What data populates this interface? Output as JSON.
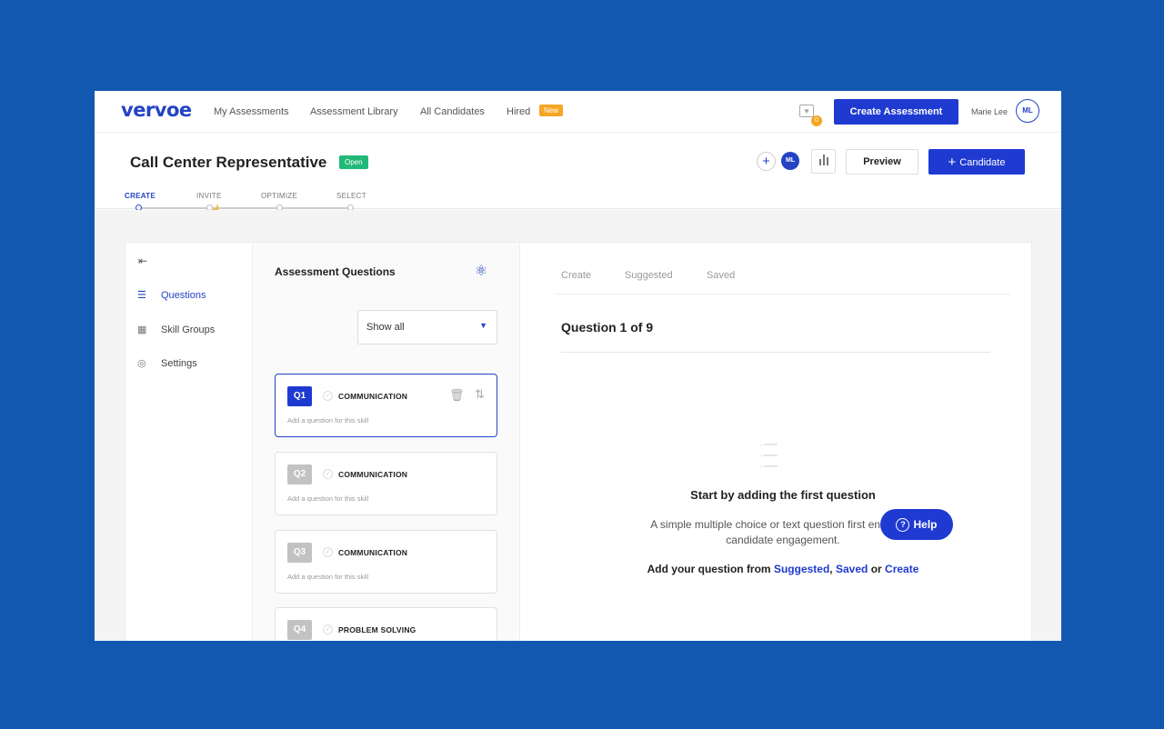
{
  "brand": {
    "logo": "vervoe"
  },
  "topnav": {
    "links": [
      "My Assessments",
      "Assessment Library",
      "All Candidates",
      "Hired"
    ],
    "hired_badge": "New",
    "favorites_count": "0",
    "create_button": "Create Assessment",
    "user_name": "Marie Lee",
    "user_initials": "ML"
  },
  "header": {
    "title": "Call Center Representative",
    "status": "Open",
    "collaborator_initials": "ML",
    "preview_button": "Preview",
    "candidate_button": "Candidate",
    "steps": [
      "CREATE",
      "INVITE",
      "OPTIMIZE",
      "SELECT"
    ],
    "active_step": "CREATE"
  },
  "sidebar": {
    "items": [
      {
        "label": "Questions",
        "icon": "list-icon",
        "active": true
      },
      {
        "label": "Skill Groups",
        "icon": "grid-icon",
        "active": false
      },
      {
        "label": "Settings",
        "icon": "gear-icon",
        "active": false
      }
    ]
  },
  "questions_panel": {
    "title": "Assessment Questions",
    "filter_value": "Show all",
    "questions": [
      {
        "num": "Q1",
        "skill": "COMMUNICATION",
        "hint": "Add a question for this skill",
        "active": true
      },
      {
        "num": "Q2",
        "skill": "COMMUNICATION",
        "hint": "Add a question for this skill",
        "active": false
      },
      {
        "num": "Q3",
        "skill": "COMMUNICATION",
        "hint": "Add a question for this skill",
        "active": false
      },
      {
        "num": "Q4",
        "skill": "PROBLEM SOLVING",
        "hint": "",
        "active": false
      }
    ]
  },
  "main": {
    "tabs": [
      "Create",
      "Suggested",
      "Saved"
    ],
    "question_heading": "Question 1 of 9",
    "empty_title": "Start by adding the first question",
    "empty_desc": "A simple multiple choice or text question first enhances candidate engagement.",
    "cta_prefix": "Add your question from",
    "cta_suggested": "Suggested",
    "cta_saved": "Saved",
    "cta_or": "or",
    "cta_create": "Create"
  },
  "help_button": "Help",
  "colors": {
    "accent": "#1f3ad1",
    "background": "#1358b0",
    "status_open": "#21b978",
    "badge_new": "#f5a623"
  }
}
